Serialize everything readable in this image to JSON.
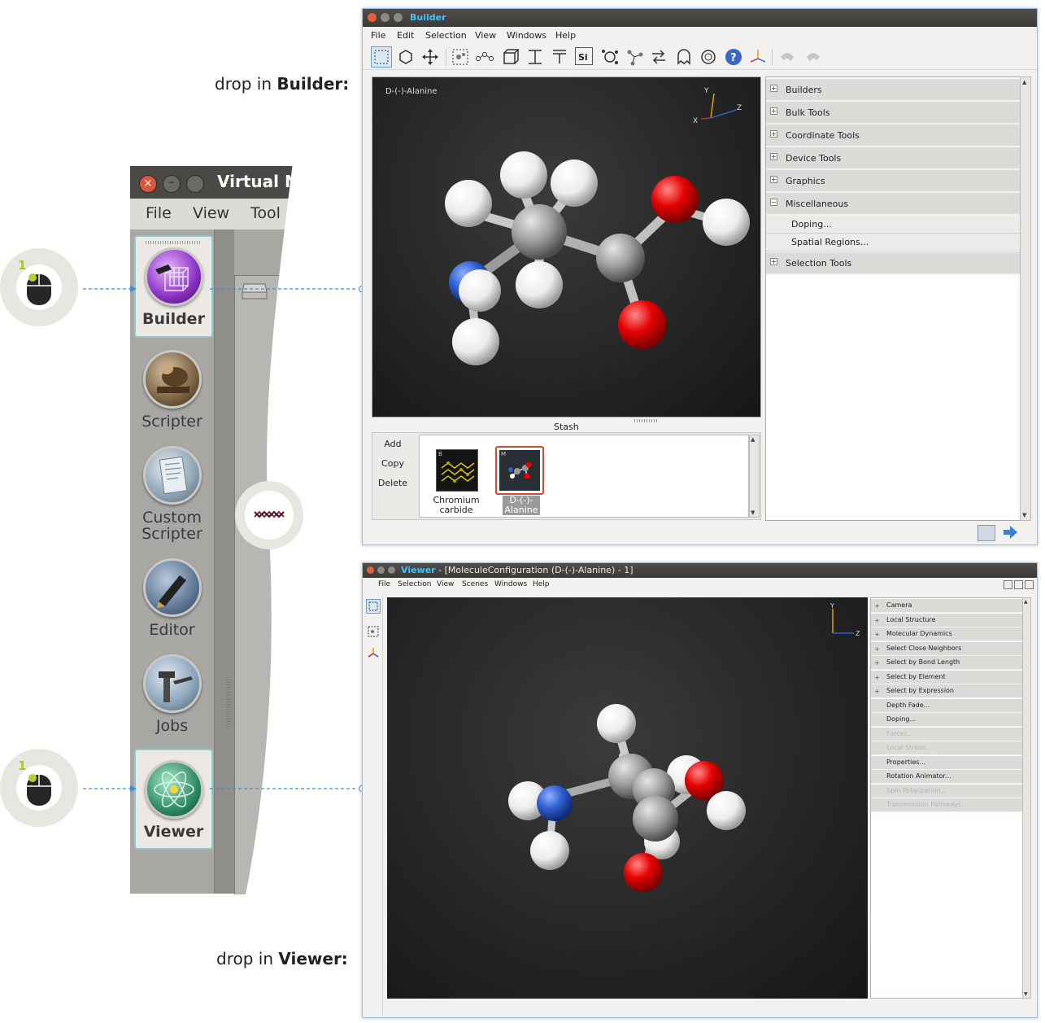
{
  "labels": {
    "drop_builder_prefix": "drop in ",
    "drop_builder_strong": "Builder:",
    "drop_viewer_prefix": "drop in ",
    "drop_viewer_strong": "Viewer:"
  },
  "badges": {
    "number": "1"
  },
  "launcher": {
    "title": "Virtual N",
    "menu": [
      "File",
      "View",
      "Tool"
    ],
    "items": [
      {
        "label": "Builder",
        "icon": "builder-icon",
        "selected": true
      },
      {
        "label": "Scripter",
        "icon": "scripter-icon"
      },
      {
        "label": "Custom Scripter",
        "icon": "custom-scripter-icon"
      },
      {
        "label": "Editor",
        "icon": "editor-icon"
      },
      {
        "label": "Jobs",
        "icon": "jobs-icon"
      },
      {
        "label": "Viewer",
        "icon": "viewer-icon",
        "selected": true
      }
    ],
    "widget_icon": "molecule-chain-icon"
  },
  "builder": {
    "title": "Builder",
    "menu": [
      "File",
      "Edit",
      "Selection",
      "View",
      "Windows",
      "Help"
    ],
    "molecule_name": "D-(-)-Alanine",
    "axes": {
      "y": "Y",
      "z": "Z",
      "x": "X"
    },
    "panel": {
      "categories": [
        {
          "label": "Builders",
          "expanded": false
        },
        {
          "label": "Bulk Tools",
          "expanded": false
        },
        {
          "label": "Coordinate Tools",
          "expanded": false
        },
        {
          "label": "Device Tools",
          "expanded": false
        },
        {
          "label": "Graphics",
          "expanded": false
        },
        {
          "label": "Miscellaneous",
          "expanded": true
        },
        {
          "label": "Selection Tools",
          "expanded": false
        }
      ],
      "misc_items": [
        "Doping...",
        "Spatial Regions..."
      ]
    },
    "stash": {
      "title": "Stash",
      "buttons": [
        "Add",
        "Copy",
        "Delete"
      ],
      "items": [
        {
          "tag": "B",
          "caption1": "Chromium",
          "caption2": "carbide",
          "selected": false
        },
        {
          "tag": "M",
          "caption1": "D-(-)-",
          "caption2": "Alanine",
          "selected": true
        }
      ]
    }
  },
  "viewer": {
    "title_app": "Viewer",
    "title_rest": " - [MoleculeConfiguration (D-(-)-Alanine) - 1]",
    "menu": [
      "File",
      "Selection",
      "View",
      "Scenes",
      "Windows",
      "Help"
    ],
    "axes": {
      "y": "Y",
      "z": "Z"
    },
    "panel": [
      {
        "label": "Camera",
        "expandable": true,
        "enabled": true
      },
      {
        "label": "Local Structure",
        "expandable": true,
        "enabled": true
      },
      {
        "label": "Molecular Dynamics",
        "expandable": true,
        "enabled": true
      },
      {
        "label": "Select Close Neighbors",
        "expandable": true,
        "enabled": true
      },
      {
        "label": "Select by Bond Length",
        "expandable": true,
        "enabled": true
      },
      {
        "label": "Select by Element",
        "expandable": true,
        "enabled": true
      },
      {
        "label": "Select by Expression",
        "expandable": true,
        "enabled": true
      },
      {
        "label": "Depth Fade...",
        "expandable": false,
        "enabled": true
      },
      {
        "label": "Doping...",
        "expandable": false,
        "enabled": true
      },
      {
        "label": "Forces...",
        "expandable": false,
        "enabled": false
      },
      {
        "label": "Local Stress...",
        "expandable": false,
        "enabled": false
      },
      {
        "label": "Properties...",
        "expandable": false,
        "enabled": true
      },
      {
        "label": "Rotation Animator...",
        "expandable": false,
        "enabled": true
      },
      {
        "label": "Spin Polarization...",
        "expandable": false,
        "enabled": false
      },
      {
        "label": "Transmission Pathways...",
        "expandable": false,
        "enabled": false
      }
    ]
  },
  "colors": {
    "accent_arrow": "#3a8fd6",
    "carbon": "#9a9a9a",
    "oxygen": "#e00000",
    "nitrogen": "#2f5fd0",
    "hydrogen": "#ffffff",
    "viewer_title": "#3fc4ff"
  }
}
